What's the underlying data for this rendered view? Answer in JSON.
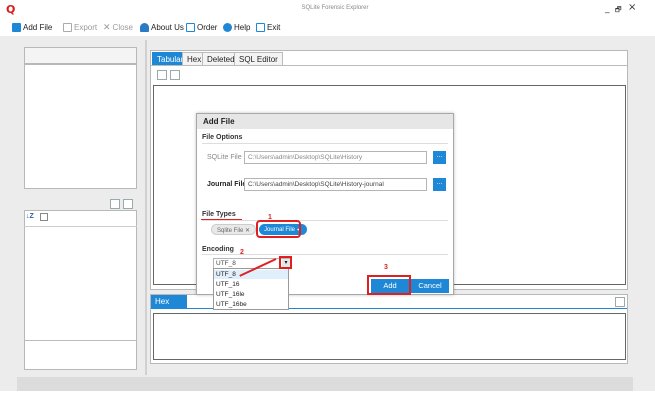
{
  "window": {
    "title": "SQLite Forensic Explorer",
    "logo_glyph": "Q",
    "minimize": "_",
    "maximize": "🗗",
    "close": "×"
  },
  "menu": {
    "add_file": "Add File",
    "export": "Export",
    "close": "Close",
    "about": "About Us",
    "order": "Order",
    "help": "Help",
    "exit": "Exit"
  },
  "tabs": [
    "Tabular",
    "Hex",
    "Deleted",
    "SQL Editor"
  ],
  "bottom_tab": "Hex",
  "left_small_toolbar": {
    "sort_glyph": "↓Z"
  },
  "dialog": {
    "title": "Add File",
    "file_options_label": "File Options",
    "sqlite_file_label": "SQLite File",
    "sqlite_file_value": "C:\\Users\\admin\\Desktop\\SQLite\\History",
    "journal_file_label": "Journal File",
    "journal_file_value": "C:\\Users\\admin\\Desktop\\SQLite\\History-journal",
    "browse_label": "...",
    "file_types_label": "File Types",
    "chips": [
      {
        "label": "Sqlite File",
        "state": "unselected"
      },
      {
        "label": "Journal File",
        "state": "selected"
      }
    ],
    "encoding_label": "Encoding",
    "encoding_value": "UTF_8",
    "encoding_options": [
      "UTF_8",
      "UTF_16",
      "UTF_16le",
      "UTF_16be"
    ],
    "add_label": "Add",
    "cancel_label": "Cancel"
  },
  "annotations": [
    "1",
    "2",
    "3"
  ],
  "colors": {
    "accent": "#1e88d6",
    "annotation": "#e02020",
    "logo": "#d81b1b"
  }
}
